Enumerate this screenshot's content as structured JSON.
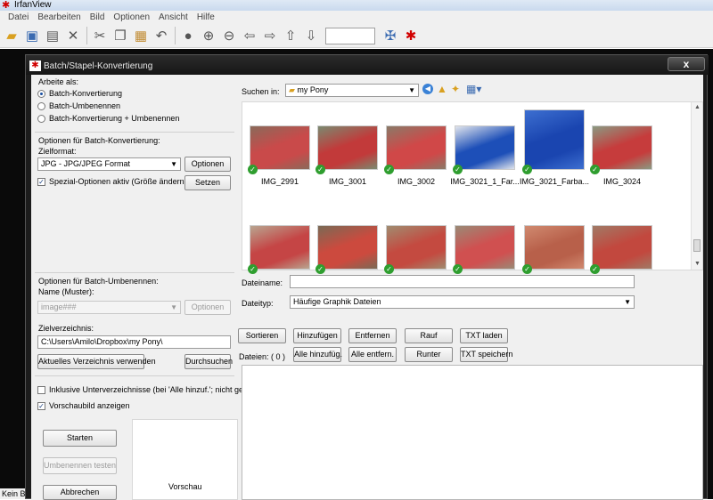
{
  "app": {
    "title": "IrfanView",
    "menu": [
      "Datei",
      "Bearbeiten",
      "Bild",
      "Optionen",
      "Ansicht",
      "Hilfe"
    ],
    "status_text": "Kein Bi"
  },
  "dialog": {
    "title": "Batch/Stapel-Konvertierung",
    "close": "x",
    "arbeite_als": {
      "label": "Arbeite als:",
      "options": [
        "Batch-Konvertierung",
        "Batch-Umbenennen",
        "Batch-Konvertierung + Umbenennen"
      ],
      "selected": 0
    },
    "convert_opts": {
      "section_label": "Optionen für Batch-Konvertierung:",
      "format_label": "Zielformat:",
      "format_value": "JPG - JPG/JPEG Format",
      "options_btn": "Optionen",
      "special_check": "Spezial-Optionen aktiv (Größe ändern etc.)",
      "special_checked": true,
      "set_btn": "Setzen"
    },
    "rename_opts": {
      "section_label": "Optionen für Batch-Umbenennen:",
      "name_label": "Name (Muster):",
      "name_value": "image###",
      "options_btn": "Optionen"
    },
    "target_dir": {
      "label": "Zielverzeichnis:",
      "value": "C:\\Users\\Amilo\\Dropbox\\my Pony\\",
      "use_current_btn": "Aktuelles Verzeichnis verwenden",
      "browse_btn": "Durchsuchen"
    },
    "checks": {
      "subdirs": "Inklusive Unterverzeichnisse (bei 'Alle hinzuf.'; nicht gesp.)",
      "subdirs_checked": false,
      "preview": "Vorschaubild anzeigen",
      "preview_checked": true
    },
    "actions": {
      "start": "Starten",
      "test_rename": "Umbenennen testen",
      "cancel": "Abbrechen"
    },
    "preview_label": "Vorschau",
    "search": {
      "label": "Suchen in:",
      "folder": "my Pony"
    },
    "thumbnails": [
      {
        "name": "IMG_2991",
        "colors": [
          "#c94a4a",
          "#8a6a5a"
        ]
      },
      {
        "name": "IMG_3001",
        "colors": [
          "#c23a3a",
          "#7a8a70"
        ]
      },
      {
        "name": "IMG_3002",
        "colors": [
          "#d04848",
          "#8a7a68"
        ]
      },
      {
        "name": "IMG_3021_1_Far...",
        "colors": [
          "#1d4fb8",
          "#e0e4ec"
        ]
      },
      {
        "name": "IMG_3021_Farba...",
        "colors": [
          "#1a45b0",
          "#3d6fd0"
        ]
      },
      {
        "name": "IMG_3024",
        "colors": [
          "#c63c3c",
          "#8a9a82"
        ]
      },
      {
        "name": "",
        "colors": [
          "#c54545",
          "#b8a590"
        ]
      },
      {
        "name": "",
        "colors": [
          "#cc4a3e",
          "#7a6a55"
        ]
      },
      {
        "name": "",
        "colors": [
          "#c44a40",
          "#a08c70"
        ]
      },
      {
        "name": "",
        "colors": [
          "#d05050",
          "#9a8a76"
        ]
      },
      {
        "name": "",
        "colors": [
          "#b8604a",
          "#d08a70"
        ]
      },
      {
        "name": "",
        "colors": [
          "#c2483e",
          "#a07a66"
        ]
      }
    ],
    "filename": {
      "name_label": "Dateiname:",
      "name_value": "",
      "type_label": "Dateityp:",
      "type_value": "Häufige Graphik Dateien"
    },
    "list_buttons": {
      "sort": "Sortieren",
      "add": "Hinzufügen",
      "remove": "Entfernen",
      "up": "Rauf",
      "load_txt": "TXT laden",
      "add_all": "Alle hinzufüg.",
      "remove_all": "Alle entfern.",
      "down": "Runter",
      "save_txt": "TXT speichern",
      "files_count": "Dateien: ( 0 )"
    }
  }
}
